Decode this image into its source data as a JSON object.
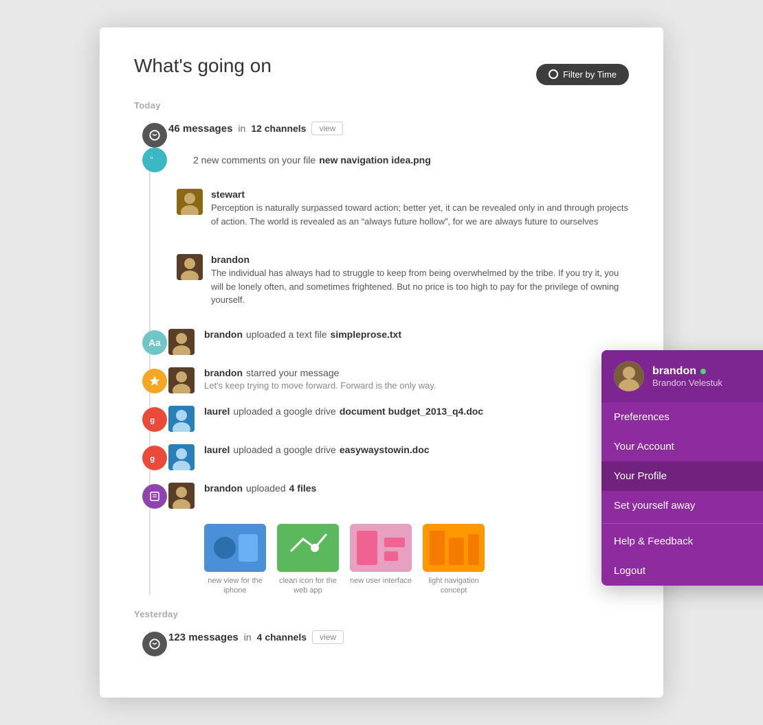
{
  "page": {
    "title": "What's going on",
    "filter_button": "Filter by Time",
    "sections": [
      {
        "label": "Today"
      },
      {
        "label": "Yesterday"
      }
    ]
  },
  "today": {
    "messages": {
      "count": "46 messages",
      "in_text": "in",
      "channels": "12 channels",
      "view": "view"
    },
    "comments": {
      "prefix": "2 new comments on your file",
      "filename": "new navigation idea.png",
      "items": [
        {
          "author": "stewart",
          "text": "Perception is naturally surpassed toward action; better yet, it can be revealed only in and through projects of action. The world is revealed as an “always future hollow”, for we are always future to ourselves"
        },
        {
          "author": "brandon",
          "text": "The individual has always had to struggle to keep from being overwhelmed by the tribe. If you try it, you will be lonely often, and sometimes frightened. But no price is too high to pay for the privilege of owning yourself."
        }
      ]
    },
    "upload_txt": {
      "user": "brandon",
      "action": "uploaded a text file",
      "filename": "simpleprose.txt"
    },
    "starred": {
      "user": "brandon",
      "action": "starred your message",
      "sub": "Let's keep trying to move forward. Forward is the only way."
    },
    "gdrive1": {
      "user": "laurel",
      "action": "uploaded a google drive",
      "filename": "document budget_2013_q4.doc"
    },
    "gdrive2": {
      "user": "laurel",
      "action": "uploaded a google drive",
      "filename": "easywaystowin.doc"
    },
    "files_upload": {
      "user": "brandon",
      "action": "uploaded",
      "count": "4 files",
      "thumbs": [
        {
          "label": "new view for the iphone"
        },
        {
          "label": "clean icon for the web app"
        },
        {
          "label": "new user interface"
        },
        {
          "label": "light navigation concept"
        }
      ]
    }
  },
  "yesterday": {
    "messages": {
      "count": "123 messages",
      "in_text": "in",
      "channels": "4 channels",
      "view": "view"
    }
  },
  "popup": {
    "username": "brandon",
    "fullname": "Brandon Velestuk",
    "online": true,
    "menu": [
      {
        "label": "Preferences",
        "active": false
      },
      {
        "label": "Your Account",
        "active": false
      },
      {
        "label": "Your Profile",
        "active": true
      },
      {
        "label": "Set yourself away",
        "active": false
      },
      {
        "divider": true
      },
      {
        "label": "Help & Feedback",
        "active": false
      },
      {
        "label": "Logout",
        "active": false
      }
    ]
  }
}
